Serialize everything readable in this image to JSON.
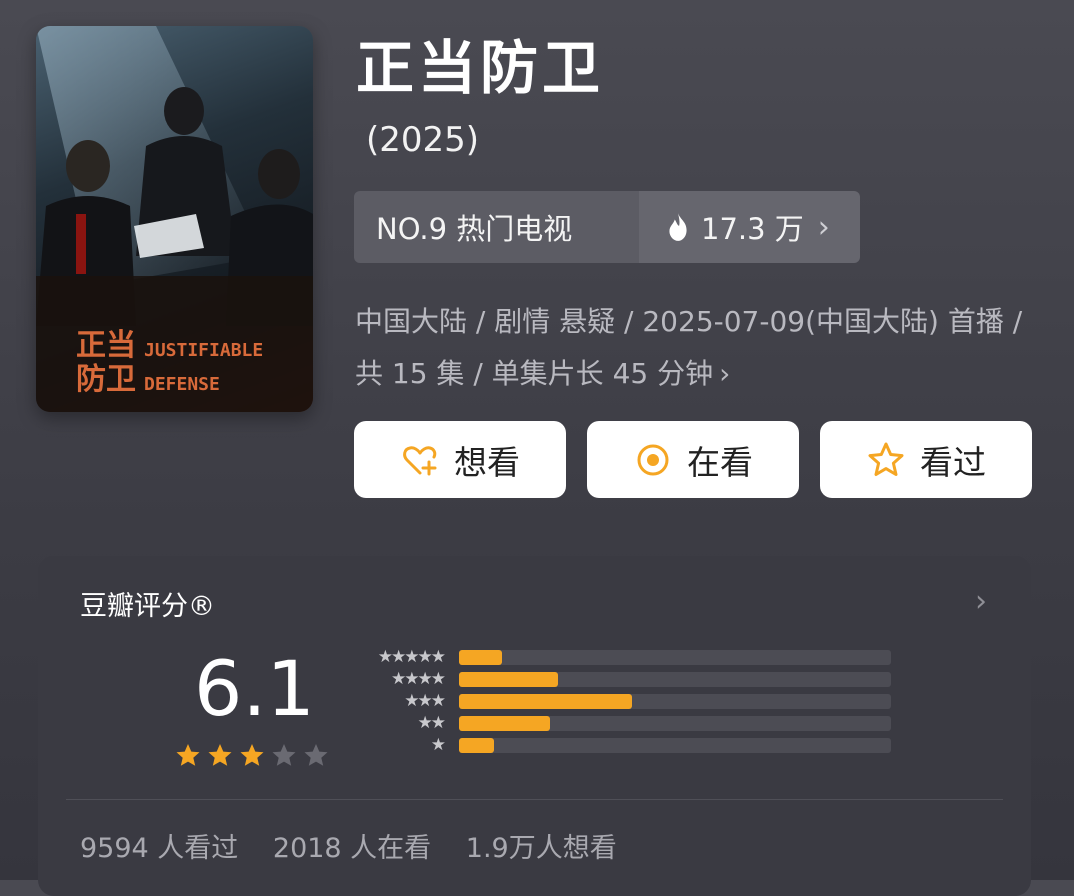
{
  "poster": {
    "title_cn_line1": "正当",
    "title_cn_line2": "防卫",
    "title_en_line1": "JUSTIFIABLE",
    "title_en_line2": "DEFENSE"
  },
  "header": {
    "title": "正当防卫",
    "year": "(2025)"
  },
  "rank": {
    "label": "NO.9 热门电视",
    "heat": "17.3 万",
    "chevron": "›"
  },
  "meta": {
    "text": "中国大陆 / 剧情 悬疑 / 2025-07-09(中国大陆) 首播 / 共 15 集 / 单集片长 45 分钟",
    "chevron": "›"
  },
  "actions": {
    "want": "想看",
    "watching": "在看",
    "watched": "看过"
  },
  "rating": {
    "title": "豆瓣评分®",
    "chevron": "›",
    "score": "6.1",
    "score_stars": 3,
    "distribution": [
      {
        "stars": "★★★★★",
        "fraction": 0.1
      },
      {
        "stars": "★★★★",
        "fraction": 0.23
      },
      {
        "stars": "★★★",
        "fraction": 0.4
      },
      {
        "stars": "★★",
        "fraction": 0.21
      },
      {
        "stars": "★",
        "fraction": 0.08
      }
    ],
    "stats": {
      "watched": "9594 人看过",
      "watching": "2018 人在看",
      "want": "1.9万人想看"
    }
  },
  "colors": {
    "accent": "#f5a623",
    "star_empty": "#6a6a72"
  }
}
